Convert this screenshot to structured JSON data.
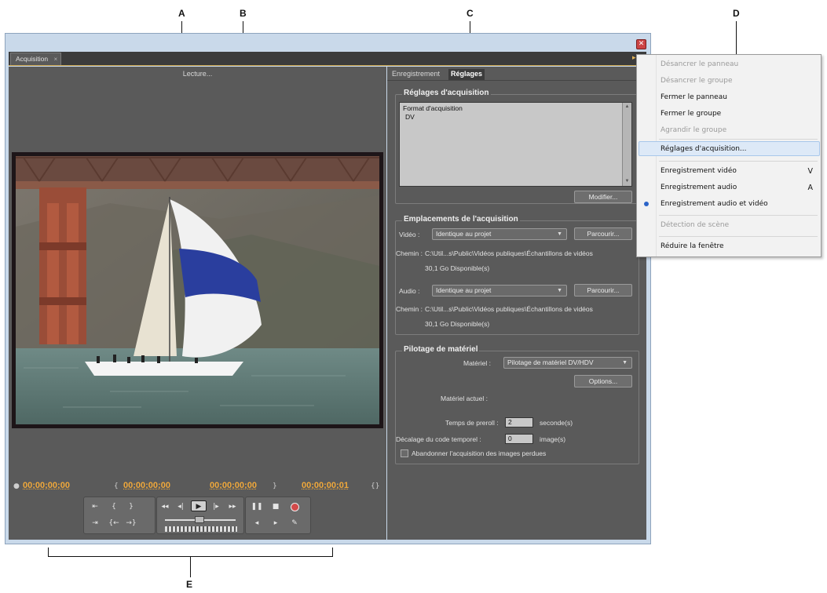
{
  "callouts": [
    "A",
    "B",
    "C",
    "D",
    "E"
  ],
  "tab_label": "Acquisition",
  "monitor": {
    "status": "Lecture...",
    "timecodes": [
      "00;00;00;00",
      "00;00;00;00",
      "00;00;00;00",
      "00;00;00;01"
    ]
  },
  "right_tabs": [
    "Enregistrement",
    "Réglages"
  ],
  "reglages_acquisition": {
    "title": "Réglages d'acquisition",
    "format_label": "Format d'acquisition",
    "format_value": "DV",
    "modify_button": "Modifier..."
  },
  "emplacements": {
    "title": "Emplacements de l'acquisition",
    "video_label": "Vidéo :",
    "video_value": "Identique au projet",
    "browse_button": "Parcourir...",
    "path_label": "Chemin :",
    "video_path": "C:\\Util...s\\Public\\Vidéos publiques\\Échantillons de vidéos",
    "video_free": "30,1 Go Disponible(s)",
    "audio_label": "Audio :",
    "audio_value": "Identique au projet",
    "audio_path": "C:\\Util...s\\Public\\Vidéos publiques\\Échantillons de vidéos",
    "audio_free": "30,1 Go Disponible(s)"
  },
  "pilotage": {
    "title": "Pilotage de matériel",
    "device_label": "Matériel :",
    "device_value": "Pilotage de matériel DV/HDV",
    "options_button": "Options...",
    "current_label": "Matériel actuel :",
    "preroll_label": "Temps de preroll :",
    "preroll_value": "2",
    "preroll_unit": "seconde(s)",
    "offset_label": "Décalage du code temporel :",
    "offset_value": "0",
    "offset_unit": "image(s)",
    "abort_label": "Abandonner l'acquisition des images perdues"
  },
  "menu": {
    "items": [
      {
        "label": "Désancrer le panneau",
        "enabled": false
      },
      {
        "label": "Désancrer le groupe",
        "enabled": false
      },
      {
        "label": "Fermer le panneau",
        "enabled": true
      },
      {
        "label": "Fermer le groupe",
        "enabled": true
      },
      {
        "label": "Agrandir le groupe",
        "enabled": false
      },
      {
        "label": "Réglages d'acquisition...",
        "enabled": true,
        "highlighted": true
      },
      {
        "label": "Enregistrement vidéo",
        "shortcut": "V",
        "enabled": true
      },
      {
        "label": "Enregistrement audio",
        "shortcut": "A",
        "enabled": true
      },
      {
        "label": "Enregistrement audio et vidéo",
        "enabled": true,
        "checked": true
      },
      {
        "label": "Détection de scène",
        "enabled": false
      },
      {
        "label": "Réduire la fenêtre",
        "enabled": true
      }
    ]
  },
  "colors": {
    "timecode": "#f0a83a",
    "panel_bg": "#5a5a5a",
    "menu_highlight": "#dde9f7"
  }
}
